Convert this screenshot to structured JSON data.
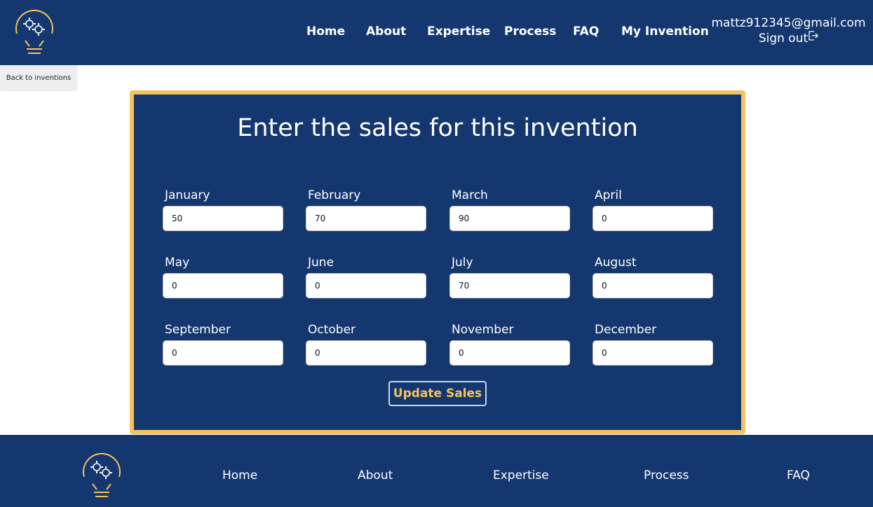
{
  "header": {
    "nav": [
      {
        "label": "Home"
      },
      {
        "label": "About"
      },
      {
        "label": "Expertise"
      },
      {
        "label": "Process"
      },
      {
        "label": "FAQ"
      },
      {
        "label": "My Invention"
      }
    ],
    "email": "mattz912345@gmail.com",
    "sign_out_label": "Sign out"
  },
  "back_label": "Back to inventions",
  "form": {
    "title": "Enter the sales for this invention",
    "months": [
      {
        "label": "January",
        "value": "50"
      },
      {
        "label": "February",
        "value": "70"
      },
      {
        "label": "March",
        "value": "90"
      },
      {
        "label": "April",
        "value": "0"
      },
      {
        "label": "May",
        "value": "0"
      },
      {
        "label": "June",
        "value": "0"
      },
      {
        "label": "July",
        "value": "70"
      },
      {
        "label": "August",
        "value": "0"
      },
      {
        "label": "September",
        "value": "0"
      },
      {
        "label": "October",
        "value": "0"
      },
      {
        "label": "November",
        "value": "0"
      },
      {
        "label": "December",
        "value": "0"
      }
    ],
    "submit_label": "Update Sales"
  },
  "footer": {
    "nav": [
      {
        "label": "Home"
      },
      {
        "label": "About"
      },
      {
        "label": "Expertise"
      },
      {
        "label": "Process"
      },
      {
        "label": "FAQ"
      }
    ]
  },
  "colors": {
    "primary": "#15376f",
    "accent": "#f6c25c",
    "white": "#ffffff"
  },
  "icons": {
    "logo": "lightbulb-gears-logo",
    "sign_out": "sign-out-icon"
  }
}
